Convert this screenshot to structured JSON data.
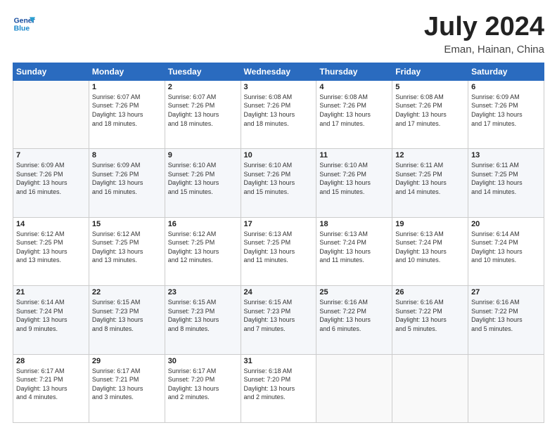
{
  "header": {
    "logo_line1": "General",
    "logo_line2": "Blue",
    "title": "July 2024",
    "subtitle": "Eman, Hainan, China"
  },
  "weekdays": [
    "Sunday",
    "Monday",
    "Tuesday",
    "Wednesday",
    "Thursday",
    "Friday",
    "Saturday"
  ],
  "weeks": [
    [
      {
        "day": "",
        "info": ""
      },
      {
        "day": "1",
        "info": "Sunrise: 6:07 AM\nSunset: 7:26 PM\nDaylight: 13 hours\nand 18 minutes."
      },
      {
        "day": "2",
        "info": "Sunrise: 6:07 AM\nSunset: 7:26 PM\nDaylight: 13 hours\nand 18 minutes."
      },
      {
        "day": "3",
        "info": "Sunrise: 6:08 AM\nSunset: 7:26 PM\nDaylight: 13 hours\nand 18 minutes."
      },
      {
        "day": "4",
        "info": "Sunrise: 6:08 AM\nSunset: 7:26 PM\nDaylight: 13 hours\nand 17 minutes."
      },
      {
        "day": "5",
        "info": "Sunrise: 6:08 AM\nSunset: 7:26 PM\nDaylight: 13 hours\nand 17 minutes."
      },
      {
        "day": "6",
        "info": "Sunrise: 6:09 AM\nSunset: 7:26 PM\nDaylight: 13 hours\nand 17 minutes."
      }
    ],
    [
      {
        "day": "7",
        "info": "Sunrise: 6:09 AM\nSunset: 7:26 PM\nDaylight: 13 hours\nand 16 minutes."
      },
      {
        "day": "8",
        "info": "Sunrise: 6:09 AM\nSunset: 7:26 PM\nDaylight: 13 hours\nand 16 minutes."
      },
      {
        "day": "9",
        "info": "Sunrise: 6:10 AM\nSunset: 7:26 PM\nDaylight: 13 hours\nand 15 minutes."
      },
      {
        "day": "10",
        "info": "Sunrise: 6:10 AM\nSunset: 7:26 PM\nDaylight: 13 hours\nand 15 minutes."
      },
      {
        "day": "11",
        "info": "Sunrise: 6:10 AM\nSunset: 7:26 PM\nDaylight: 13 hours\nand 15 minutes."
      },
      {
        "day": "12",
        "info": "Sunrise: 6:11 AM\nSunset: 7:25 PM\nDaylight: 13 hours\nand 14 minutes."
      },
      {
        "day": "13",
        "info": "Sunrise: 6:11 AM\nSunset: 7:25 PM\nDaylight: 13 hours\nand 14 minutes."
      }
    ],
    [
      {
        "day": "14",
        "info": "Sunrise: 6:12 AM\nSunset: 7:25 PM\nDaylight: 13 hours\nand 13 minutes."
      },
      {
        "day": "15",
        "info": "Sunrise: 6:12 AM\nSunset: 7:25 PM\nDaylight: 13 hours\nand 13 minutes."
      },
      {
        "day": "16",
        "info": "Sunrise: 6:12 AM\nSunset: 7:25 PM\nDaylight: 13 hours\nand 12 minutes."
      },
      {
        "day": "17",
        "info": "Sunrise: 6:13 AM\nSunset: 7:25 PM\nDaylight: 13 hours\nand 11 minutes."
      },
      {
        "day": "18",
        "info": "Sunrise: 6:13 AM\nSunset: 7:24 PM\nDaylight: 13 hours\nand 11 minutes."
      },
      {
        "day": "19",
        "info": "Sunrise: 6:13 AM\nSunset: 7:24 PM\nDaylight: 13 hours\nand 10 minutes."
      },
      {
        "day": "20",
        "info": "Sunrise: 6:14 AM\nSunset: 7:24 PM\nDaylight: 13 hours\nand 10 minutes."
      }
    ],
    [
      {
        "day": "21",
        "info": "Sunrise: 6:14 AM\nSunset: 7:24 PM\nDaylight: 13 hours\nand 9 minutes."
      },
      {
        "day": "22",
        "info": "Sunrise: 6:15 AM\nSunset: 7:23 PM\nDaylight: 13 hours\nand 8 minutes."
      },
      {
        "day": "23",
        "info": "Sunrise: 6:15 AM\nSunset: 7:23 PM\nDaylight: 13 hours\nand 8 minutes."
      },
      {
        "day": "24",
        "info": "Sunrise: 6:15 AM\nSunset: 7:23 PM\nDaylight: 13 hours\nand 7 minutes."
      },
      {
        "day": "25",
        "info": "Sunrise: 6:16 AM\nSunset: 7:22 PM\nDaylight: 13 hours\nand 6 minutes."
      },
      {
        "day": "26",
        "info": "Sunrise: 6:16 AM\nSunset: 7:22 PM\nDaylight: 13 hours\nand 5 minutes."
      },
      {
        "day": "27",
        "info": "Sunrise: 6:16 AM\nSunset: 7:22 PM\nDaylight: 13 hours\nand 5 minutes."
      }
    ],
    [
      {
        "day": "28",
        "info": "Sunrise: 6:17 AM\nSunset: 7:21 PM\nDaylight: 13 hours\nand 4 minutes."
      },
      {
        "day": "29",
        "info": "Sunrise: 6:17 AM\nSunset: 7:21 PM\nDaylight: 13 hours\nand 3 minutes."
      },
      {
        "day": "30",
        "info": "Sunrise: 6:17 AM\nSunset: 7:20 PM\nDaylight: 13 hours\nand 2 minutes."
      },
      {
        "day": "31",
        "info": "Sunrise: 6:18 AM\nSunset: 7:20 PM\nDaylight: 13 hours\nand 2 minutes."
      },
      {
        "day": "",
        "info": ""
      },
      {
        "day": "",
        "info": ""
      },
      {
        "day": "",
        "info": ""
      }
    ]
  ]
}
